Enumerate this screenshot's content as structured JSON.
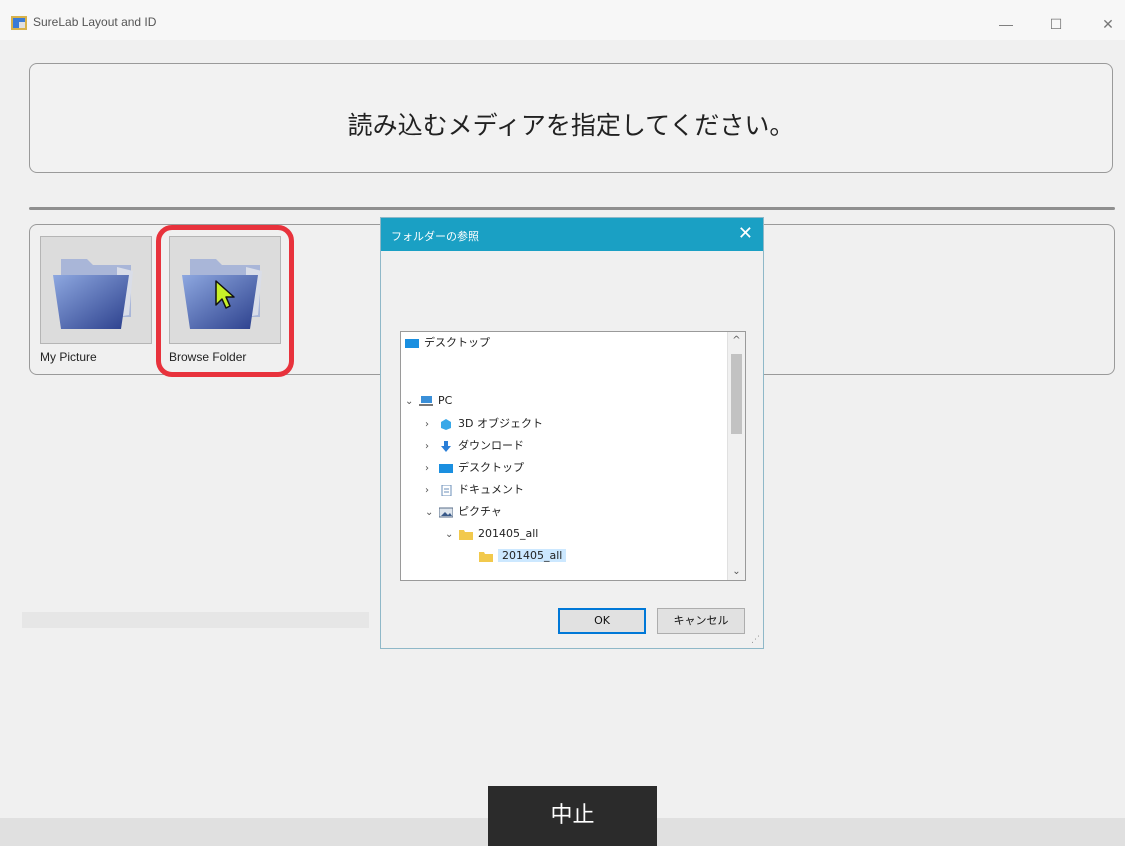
{
  "window": {
    "title": "SureLab Layout and ID",
    "minimize": "—",
    "maximize": "☐",
    "close": "✕"
  },
  "instruction": "読み込むメディアを指定してください。",
  "media": {
    "tiles": [
      {
        "label": "My Picture"
      },
      {
        "label": "Browse Folder"
      }
    ]
  },
  "dialog": {
    "title": "フォルダーの参照",
    "close": "✕",
    "tree": [
      {
        "label": "デスクトップ",
        "icon": "desktop-icon",
        "chevron": ""
      },
      {
        "label": "PC",
        "icon": "pc-icon",
        "chevron": "⌄"
      },
      {
        "label": "3D オブジェクト",
        "icon": "3d-objects-icon",
        "chevron": "›"
      },
      {
        "label": "ダウンロード",
        "icon": "download-icon",
        "chevron": "›"
      },
      {
        "label": "デスクトップ",
        "icon": "desktop-icon",
        "chevron": "›"
      },
      {
        "label": "ドキュメント",
        "icon": "documents-icon",
        "chevron": "›"
      },
      {
        "label": "ピクチャ",
        "icon": "pictures-icon",
        "chevron": "⌄"
      },
      {
        "label": "201405_all",
        "icon": "folder-icon",
        "chevron": "⌄"
      },
      {
        "label": "201405_all",
        "icon": "folder-icon",
        "chevron": ""
      }
    ],
    "scroll_up": "^",
    "scroll_down": "⌄",
    "ok": "OK",
    "cancel": "キャンセル"
  },
  "stop_button": "中止",
  "colors": {
    "accent": "#1aa0c4",
    "highlight": "#e8323c",
    "selection": "#cce8ff"
  }
}
